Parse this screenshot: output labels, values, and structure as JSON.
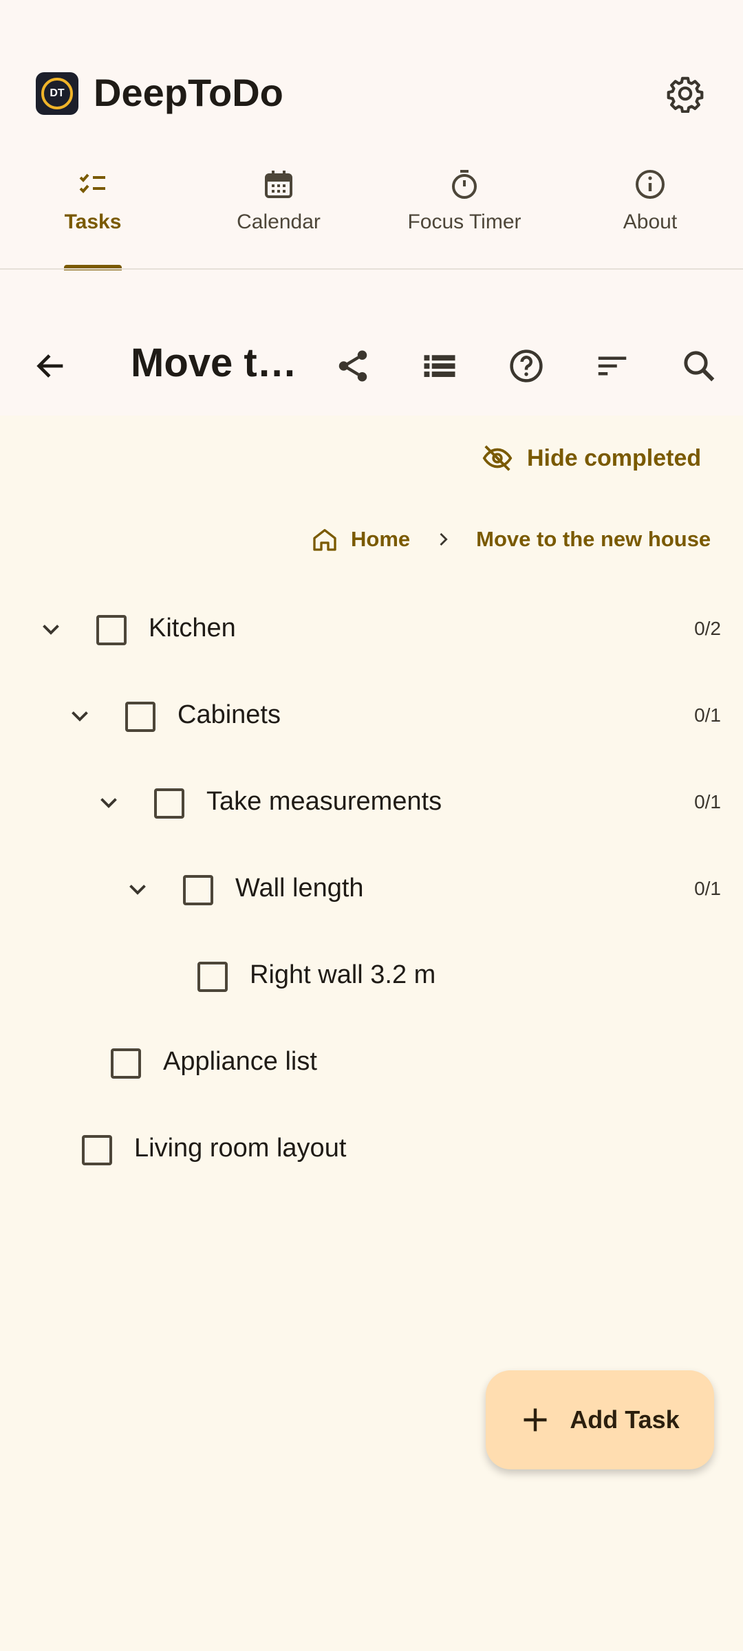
{
  "app": {
    "title": "DeepToDo",
    "logo_text": "DT"
  },
  "tabs": [
    {
      "label": "Tasks",
      "icon": "tasks-icon",
      "active": true
    },
    {
      "label": "Calendar",
      "icon": "calendar-icon",
      "active": false
    },
    {
      "label": "Focus Timer",
      "icon": "timer-icon",
      "active": false
    },
    {
      "label": "About",
      "icon": "info-icon",
      "active": false
    }
  ],
  "toolbar": {
    "title": "Move t…",
    "icons": [
      "back-arrow-icon",
      "share-icon",
      "list-view-icon",
      "help-icon",
      "sort-icon",
      "search-icon"
    ]
  },
  "filter": {
    "hide_completed_label": "Hide completed"
  },
  "breadcrumb": {
    "home": "Home",
    "current": "Move to the new house"
  },
  "tasks": [
    {
      "name": "Kitchen",
      "count": "0/2",
      "expandable": true
    },
    {
      "name": "Cabinets",
      "count": "0/1",
      "expandable": true
    },
    {
      "name": "Take measurements",
      "count": "0/1",
      "expandable": true
    },
    {
      "name": "Wall length",
      "count": "0/1",
      "expandable": true
    },
    {
      "name": "Right wall 3.2 m",
      "count": "",
      "expandable": false
    },
    {
      "name": "Appliance list",
      "count": "",
      "expandable": false
    },
    {
      "name": "Living room layout",
      "count": "",
      "expandable": false
    }
  ],
  "fab": {
    "label": "Add Task"
  },
  "colors": {
    "accent": "#7a5a00",
    "background": "#fdf8ec",
    "fab": "#ffddb0"
  }
}
